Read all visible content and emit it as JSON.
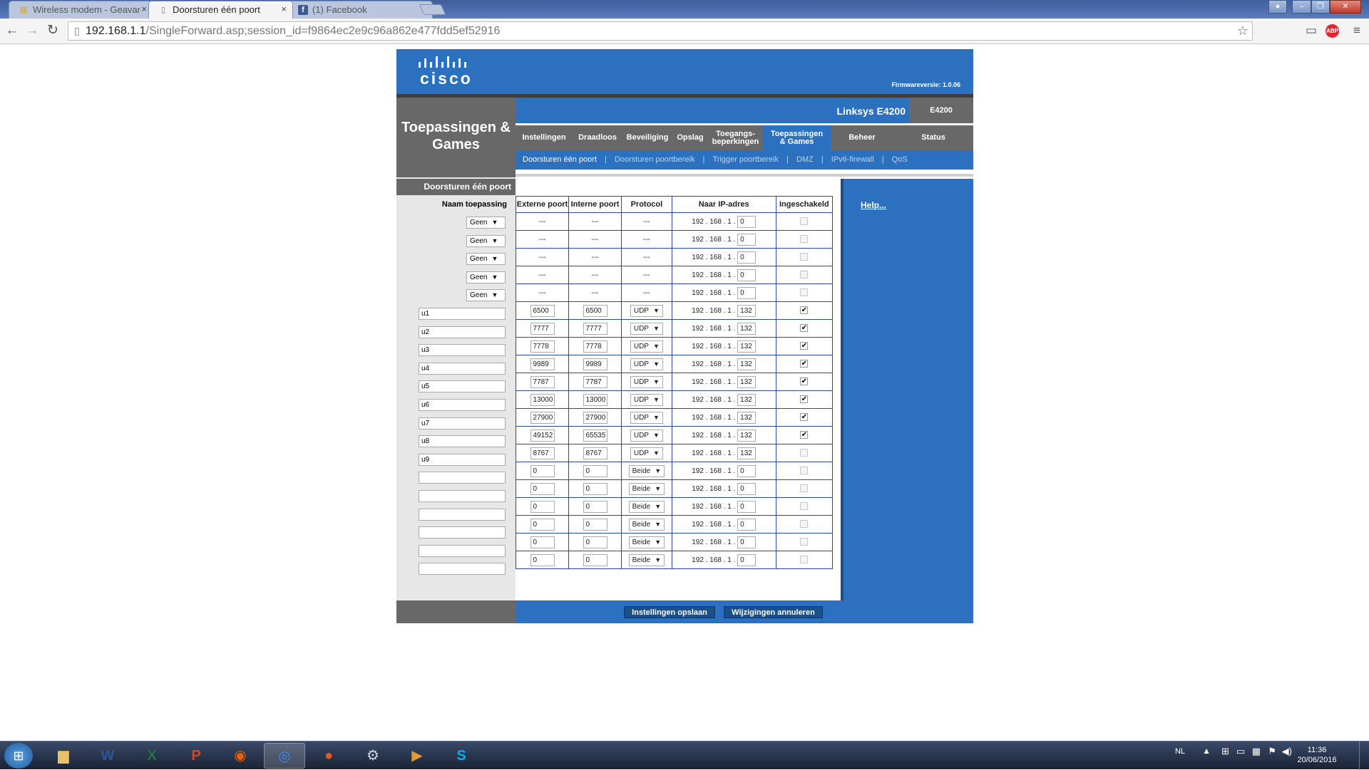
{
  "browser": {
    "tabs": [
      {
        "title": "Wireless modem - Geavanc",
        "icon": "page-icon",
        "active": false
      },
      {
        "title": "Doorsturen één poort",
        "icon": "page-icon",
        "active": true
      },
      {
        "title": "(1) Facebook",
        "icon": "facebook-icon",
        "active": false
      }
    ],
    "close_glyph": "×",
    "url_host": "192.168.1.1",
    "url_path": "/SingleForward.asp;session_id=f9864ec2e9c96a862e477fdd5ef52916",
    "abp_label": "ABP"
  },
  "router": {
    "brand": "cisco",
    "firmware": "Firmwareversie: 1.0.06",
    "model_name": "Linksys E4200",
    "model_number": "E4200",
    "section_title": "Toepassingen & Games",
    "main_nav": [
      {
        "label": "Instellingen",
        "active": false
      },
      {
        "label": "Draadloos",
        "active": false
      },
      {
        "label": "Beveiliging",
        "active": false
      },
      {
        "label": "Opslag",
        "active": false
      },
      {
        "label": "Toegangs-beperkingen",
        "active": false
      },
      {
        "label": "Toepassingen & Games",
        "active": true
      },
      {
        "label": "Beheer",
        "active": false
      },
      {
        "label": "Status",
        "active": false
      }
    ],
    "sub_nav": [
      {
        "label": "Doorsturen één poort",
        "active": true
      },
      {
        "label": "Doorsturen poortbereik",
        "active": false
      },
      {
        "label": "Trigger poortbereik",
        "active": false
      },
      {
        "label": "DMZ",
        "active": false
      },
      {
        "label": "IPv6-firewall",
        "active": false
      },
      {
        "label": "QoS",
        "active": false
      }
    ],
    "subnav_sep": "|",
    "left_heading": "Doorsturen één poort",
    "name_column_label": "Naam toepassing",
    "help_label": "Help...",
    "columns": [
      "Externe poort",
      "Interne poort",
      "Protocol",
      "Naar IP-adres",
      "Ingeschakeld"
    ],
    "ip_prefix": "192 . 168 . 1 .",
    "dash": "---",
    "rows": [
      {
        "name_type": "select",
        "name": "Geen",
        "ext": "---",
        "int": "---",
        "proto": "---",
        "ip": "0",
        "enabled": false
      },
      {
        "name_type": "select",
        "name": "Geen",
        "ext": "---",
        "int": "---",
        "proto": "---",
        "ip": "0",
        "enabled": false
      },
      {
        "name_type": "select",
        "name": "Geen",
        "ext": "---",
        "int": "---",
        "proto": "---",
        "ip": "0",
        "enabled": false
      },
      {
        "name_type": "select",
        "name": "Geen",
        "ext": "---",
        "int": "---",
        "proto": "---",
        "ip": "0",
        "enabled": false
      },
      {
        "name_type": "select",
        "name": "Geen",
        "ext": "---",
        "int": "---",
        "proto": "---",
        "ip": "0",
        "enabled": false
      },
      {
        "name_type": "text",
        "name": "u1",
        "ext": "6500",
        "int": "6500",
        "proto": "UDP",
        "ip": "132",
        "enabled": true
      },
      {
        "name_type": "text",
        "name": "u2",
        "ext": "7777",
        "int": "7777",
        "proto": "UDP",
        "ip": "132",
        "enabled": true
      },
      {
        "name_type": "text",
        "name": "u3",
        "ext": "7778",
        "int": "7778",
        "proto": "UDP",
        "ip": "132",
        "enabled": true
      },
      {
        "name_type": "text",
        "name": "u4",
        "ext": "9989",
        "int": "9989",
        "proto": "UDP",
        "ip": "132",
        "enabled": true
      },
      {
        "name_type": "text",
        "name": "u5",
        "ext": "7787",
        "int": "7787",
        "proto": "UDP",
        "ip": "132",
        "enabled": true
      },
      {
        "name_type": "text",
        "name": "u6",
        "ext": "13000",
        "int": "13000",
        "proto": "UDP",
        "ip": "132",
        "enabled": true
      },
      {
        "name_type": "text",
        "name": "u7",
        "ext": "27900",
        "int": "27900",
        "proto": "UDP",
        "ip": "132",
        "enabled": true
      },
      {
        "name_type": "text",
        "name": "u8",
        "ext": "49152",
        "int": "65535",
        "proto": "UDP",
        "ip": "132",
        "enabled": true
      },
      {
        "name_type": "text",
        "name": "u9",
        "ext": "8767",
        "int": "8767",
        "proto": "UDP",
        "ip": "132",
        "enabled": false
      },
      {
        "name_type": "text",
        "name": "",
        "ext": "0",
        "int": "0",
        "proto": "Beide",
        "ip": "0",
        "enabled": false
      },
      {
        "name_type": "text",
        "name": "",
        "ext": "0",
        "int": "0",
        "proto": "Beide",
        "ip": "0",
        "enabled": false
      },
      {
        "name_type": "text",
        "name": "",
        "ext": "0",
        "int": "0",
        "proto": "Beide",
        "ip": "0",
        "enabled": false
      },
      {
        "name_type": "text",
        "name": "",
        "ext": "0",
        "int": "0",
        "proto": "Beide",
        "ip": "0",
        "enabled": false
      },
      {
        "name_type": "text",
        "name": "",
        "ext": "0",
        "int": "0",
        "proto": "Beide",
        "ip": "0",
        "enabled": false
      },
      {
        "name_type": "text",
        "name": "",
        "ext": "0",
        "int": "0",
        "proto": "Beide",
        "ip": "0",
        "enabled": false
      }
    ],
    "save_label": "Instellingen opslaan",
    "cancel_label": "Wijzigingen annuleren"
  },
  "taskbar": {
    "apps": [
      "windows-explorer-icon",
      "word-icon",
      "excel-icon",
      "powerpoint-icon",
      "firefox-icon",
      "chrome-icon",
      "media-player-icon",
      "steam-icon",
      "video-player-icon",
      "skype-icon"
    ],
    "language": "NL",
    "time": "11:36",
    "date": "20/06/2016"
  },
  "colors": {
    "cisco_blue": "#2b71c0",
    "cisco_grey": "#686868"
  }
}
